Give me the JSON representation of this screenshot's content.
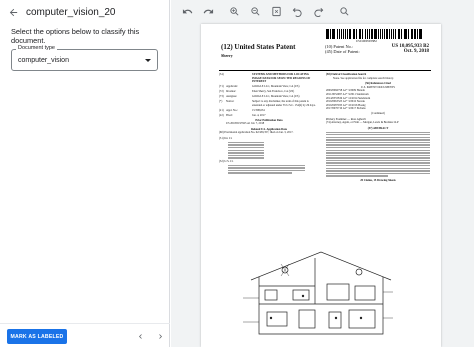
{
  "app": {
    "title": "computer_vision_20",
    "instructions": "Select the options below to classify this document."
  },
  "form": {
    "field_label": "Document type",
    "field_value": "computer_vision"
  },
  "footer": {
    "mark_label": "MARK AS LABELED"
  },
  "viewer": {
    "toolbar_icons": [
      "undo-icon",
      "redo-icon",
      "zoom-in-icon",
      "zoom-out-icon",
      "fit-page-icon",
      "rotate-left-icon",
      "rotate-right-icon",
      "search-icon"
    ]
  },
  "document": {
    "barcode_text": "US010095933B2",
    "country": "(12) United States Patent",
    "inventor_short": "Sherry",
    "patent_no_label": "(10) Patent No.:",
    "patent_no": "US 10,095,933 B2",
    "date_label": "(45) Date of Patent:",
    "date": "Oct. 9, 2018",
    "bib": [
      {
        "num": "(54)",
        "key": "",
        "val": "SYSTEMS AND METHODS FOR LOCATING IMAGE DATA FOR SELECTED REGIONS OF INTEREST",
        "bold": true
      },
      {
        "num": "(71)",
        "key": "Applicant:",
        "val": "GOOGLE LLC, Mountain View, CA (US)"
      },
      {
        "num": "(72)",
        "key": "Inventor:",
        "val": "Eden Sherry, San Francisco, CA (US)"
      },
      {
        "num": "(73)",
        "key": "Assignee:",
        "val": "GOOGLE LLC, Mountain View, CA (US)"
      },
      {
        "num": "(*)",
        "key": "Notice:",
        "val": "Subject to any disclaimer, the term of this patent is extended or adjusted under 35 U.S.C. 154(b) by 29 days."
      },
      {
        "num": "(21)",
        "key": "Appl. No.:",
        "val": "15/398,634"
      },
      {
        "num": "(22)",
        "key": "Filed:",
        "val": "Jan. 4, 2017"
      }
    ],
    "prior_pub_title": "Prior Publication Data",
    "prior_pub": "US 2018/0197925 A1    Jul. 7, 2018",
    "related_title": "Related U.S. Application Data",
    "related": "(60) Provisional application No. 62/439,357, filed on Jan. 3, 2017.",
    "intcl_label": "(51) Int. Cl.",
    "uscl_label": "(52) U.S. Cl.",
    "field_search_title": "(58) Field of Classification Search",
    "field_search": "None. See application file for complete search history.",
    "refs_title": "(56) References Cited",
    "refs_sub": "U.S. PATENT DOCUMENTS",
    "refs": [
      "2009/0066758 A1*  3/2009 Harada",
      "2011/0052097 A1*  3/2011 Sundstrom",
      "2014/0355819 A1*  12/2014 Sundstrom",
      "2016/0063325 A1*  3/2016 Nowak",
      "2016/0287935 A1*  10/2016 Hoang",
      "2017/0070710 A1*  3/2017 Eichens"
    ],
    "continued": "(Continued)",
    "examiner": "Primary Examiner — Ross Aghevli",
    "attorney": "(74) Attorney, Agent, or Firm — Morgan, Lewis & Bockius LLP",
    "abstract_title": "(57)  ABSTRACT",
    "claims": "20 Claims, 15 Drawing Sheets"
  }
}
